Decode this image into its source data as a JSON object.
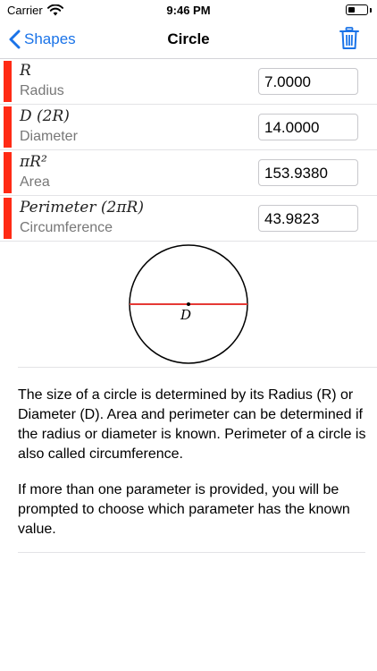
{
  "status_bar": {
    "carrier": "Carrier",
    "time": "9:46 PM",
    "battery_level": 0.35
  },
  "nav": {
    "back_label": "Shapes",
    "title": "Circle",
    "accent_color": "#1a73e8"
  },
  "parameters": [
    {
      "formula": "R",
      "name": "Radius",
      "value": "7.0000"
    },
    {
      "formula": "D (2R)",
      "name": "Diameter",
      "value": "14.0000"
    },
    {
      "formula": "πR²",
      "name": "Area",
      "value": "153.9380"
    },
    {
      "formula": "Perimeter (2πR)",
      "name": "Circumference",
      "value": "43.9823"
    }
  ],
  "diagram": {
    "diameter_label": "D",
    "line_color": "#e53935"
  },
  "description": {
    "paragraph1": "The size of a circle is determined by its Radius (R) or Diameter (D). Area and perimeter can be determined if the radius or diameter is known. Perimeter of a circle is also called circumference.",
    "paragraph2": "If more than one parameter is provided, you will be prompted to choose which parameter has the known value."
  }
}
